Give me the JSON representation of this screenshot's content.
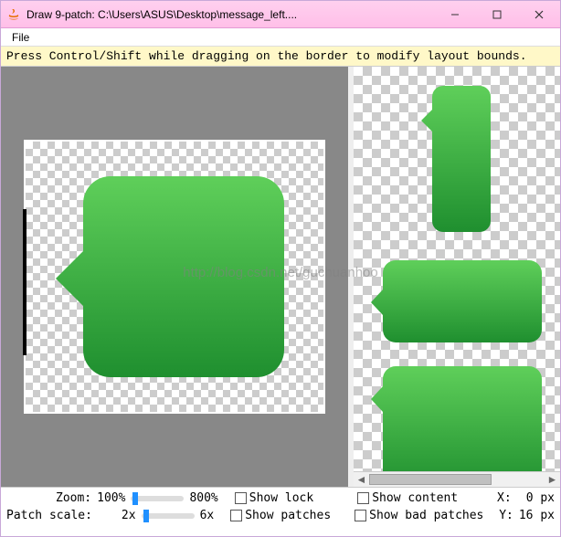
{
  "window": {
    "title": "Draw 9-patch: C:\\Users\\ASUS\\Desktop\\message_left...."
  },
  "menu": {
    "file": "File"
  },
  "hint": "Press Control/Shift while dragging on the border to modify layout bounds.",
  "controls": {
    "zoom_label": "Zoom:",
    "zoom_min": "100%",
    "zoom_max": "800%",
    "patch_scale_label": "Patch scale:",
    "patch_min": "2x",
    "patch_max": "6x",
    "show_lock": "Show lock",
    "show_patches": "Show patches",
    "show_content": "Show content",
    "show_bad_patches": "Show bad patches",
    "coord_x_label": "X:",
    "coord_x_val": "0 px",
    "coord_y_label": "Y:",
    "coord_y_val": "16 px"
  },
  "colors": {
    "bubble_top": "#5fcf5a",
    "bubble_bottom": "#1f8f2f"
  },
  "watermark": "http://blog.csdn.net/guchuanhoo"
}
